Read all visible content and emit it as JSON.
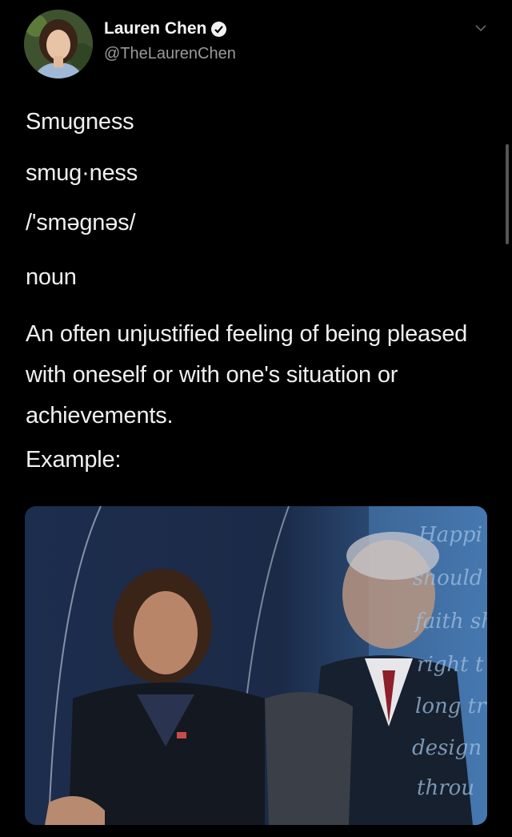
{
  "tweet": {
    "author_name": "Lauren Chen",
    "author_handle": "@TheLaurenChen",
    "lines": {
      "word": "Smugness",
      "syllables": "smug·ness",
      "pronunciation": "/'sməgnəs/",
      "part_of_speech": "noun",
      "definition": "An often unjustified feeling of being pleased with oneself or with one's situation or achievements.",
      "example": "Example:"
    },
    "image_background_text": [
      "Happi",
      "should",
      "faith sh",
      "right t",
      "long tr",
      "design",
      "throu"
    ]
  },
  "colors": {
    "background": "#000000",
    "text": "#f0f0f0",
    "handle": "#9a9a9a"
  },
  "icons": [
    "verified-badge-icon",
    "chevron-down-icon"
  ]
}
